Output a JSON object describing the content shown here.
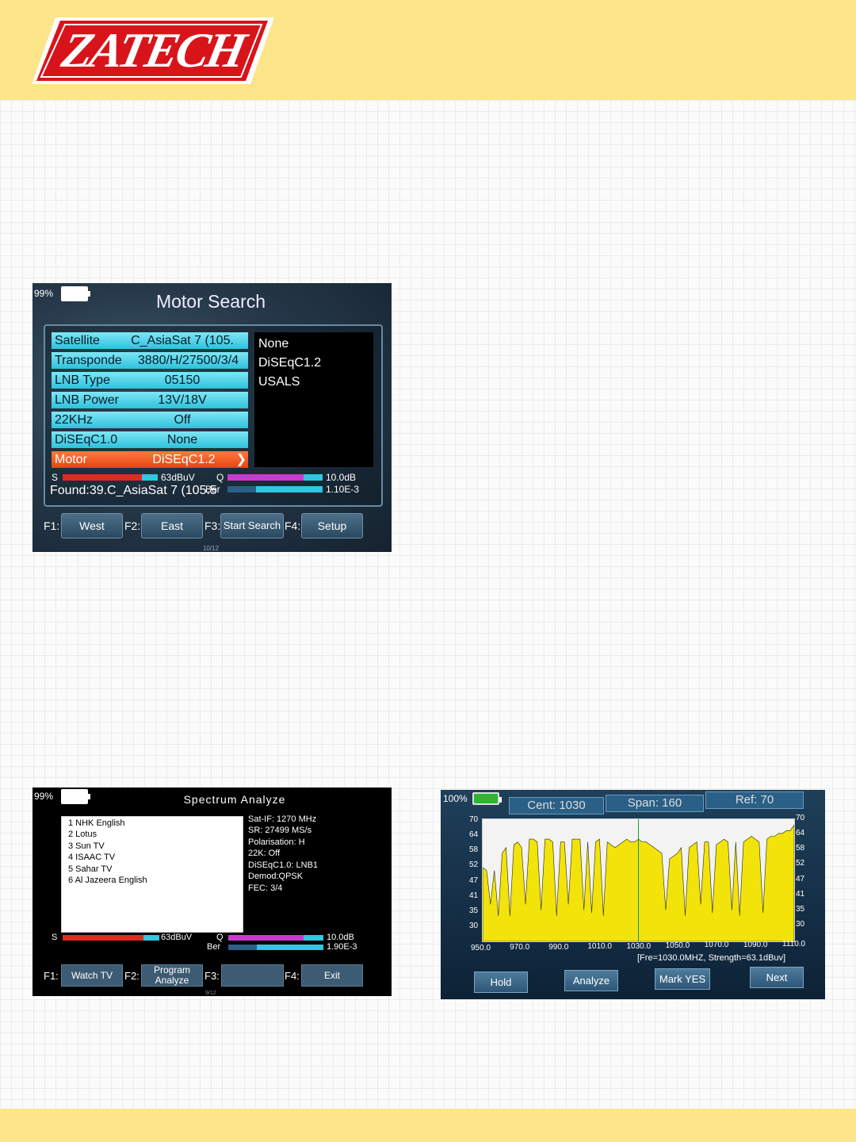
{
  "brand": {
    "logo_text": "ZATECH"
  },
  "motor_search": {
    "battery": "99%",
    "title": "Motor Search",
    "rows": [
      {
        "label": "Satellite",
        "value": "C_AsiaSat 7 (105."
      },
      {
        "label": "Transponde",
        "value": "3880/H/27500/3/4"
      },
      {
        "label": "LNB Type",
        "value": "05150"
      },
      {
        "label": "LNB Power",
        "value": "13V/18V"
      },
      {
        "label": "22KHz",
        "value": "Off"
      },
      {
        "label": "DiSEqC1.0",
        "value": "None"
      },
      {
        "label": "Motor",
        "value": "DiSEqC1.2"
      }
    ],
    "options": [
      "None",
      "DiSEqC1.2",
      "USALS"
    ],
    "s_label": "S",
    "s_value": "63dBuV",
    "q_label": "Q",
    "q_value": "10.0dB",
    "ber_label": "Ber",
    "ber_value": "1.10E-3",
    "found": "Found:39.C_AsiaSat 7 (105.5",
    "f1": "F1:",
    "f1_btn": "West",
    "f2": "F2:",
    "f2_btn": "East",
    "f3": "F3:",
    "f3_btn": "Start Search",
    "f4": "F4:",
    "f4_btn": "Setup",
    "page": "10/12"
  },
  "spectrum_analyze": {
    "battery": "99%",
    "title": "Spectrum Analyze",
    "channels": [
      "1  NHK English",
      "2  Lotus",
      "3  Sun TV",
      "4  ISAAC TV",
      "5  Sahar TV",
      "6  Al Jazeera English"
    ],
    "info": [
      "Sat-IF: 1270 MHz",
      "SR: 27499 MS/s",
      "Polarisation: H",
      "22K: Off",
      "DiSEqC1.0: LNB1",
      "Demod:QPSK",
      "FEC: 3/4"
    ],
    "s_label": "S",
    "s_value": "63dBuV",
    "q_label": "Q",
    "q_value": "10.0dB",
    "ber_label": "Ber",
    "ber_value": "1.90E-3",
    "f1": "F1:",
    "f1_btn": "Watch TV",
    "f2": "F2:",
    "f2_btn_line1": "Program",
    "f2_btn_line2": "Analyze",
    "f3": "F3:",
    "f3_btn": "",
    "f4": "F4:",
    "f4_btn": "Exit",
    "page": "9/12"
  },
  "spectrum_plot": {
    "battery": "100%",
    "cent": "Cent: 1030",
    "span": "Span: 160",
    "ref": "Ref: 70",
    "readout": "[Fre=1030.0MHZ, Strength=63.1dBuv]",
    "buttons": [
      "Hold",
      "Analyze",
      "Mark YES",
      "Next"
    ]
  },
  "chart_data": {
    "type": "area",
    "y_ticks": [
      "70",
      "64",
      "58",
      "52",
      "47",
      "41",
      "35",
      "30"
    ],
    "y_ticks_right": [
      "70",
      "64",
      "58",
      "52",
      "47",
      "41",
      "35",
      "30"
    ],
    "x_ticks": [
      "950.0",
      "970.0",
      "990.0",
      "1010.0",
      "1030.0",
      "1050.0",
      "1070.0",
      "1090.0",
      "1110.0"
    ],
    "xlim": [
      950,
      1110
    ],
    "ylim": [
      27,
      70
    ],
    "marker_x": 1030,
    "fill_color": "#f2e30a",
    "x": [
      950,
      952,
      954,
      956,
      958,
      960,
      962,
      964,
      966,
      968,
      970,
      972,
      974,
      976,
      978,
      980,
      982,
      984,
      986,
      988,
      990,
      992,
      994,
      996,
      998,
      1000,
      1002,
      1004,
      1006,
      1008,
      1010,
      1012,
      1014,
      1016,
      1018,
      1020,
      1022,
      1024,
      1026,
      1028,
      1030,
      1032,
      1034,
      1036,
      1038,
      1040,
      1042,
      1044,
      1046,
      1048,
      1050,
      1052,
      1054,
      1056,
      1058,
      1060,
      1062,
      1064,
      1066,
      1068,
      1070,
      1072,
      1074,
      1076,
      1078,
      1080,
      1082,
      1084,
      1086,
      1088,
      1090,
      1092,
      1094,
      1096,
      1098,
      1100,
      1102,
      1104,
      1106,
      1108,
      1110
    ],
    "values": [
      53,
      52,
      40,
      52,
      36,
      58,
      60,
      36,
      61,
      62,
      60,
      40,
      63,
      63,
      62,
      38,
      63,
      63,
      62,
      36,
      62,
      62,
      40,
      63,
      63,
      63,
      38,
      62,
      37,
      62,
      63,
      36,
      62,
      61,
      60,
      61,
      62,
      63,
      62,
      62,
      63,
      62,
      62,
      61,
      60,
      59,
      58,
      38,
      56,
      57,
      58,
      60,
      36,
      60,
      61,
      62,
      40,
      62,
      62,
      37,
      61,
      62,
      63,
      62,
      38,
      62,
      36,
      62,
      63,
      64,
      63,
      62,
      37,
      63,
      64,
      64,
      65,
      65,
      66,
      66,
      68
    ]
  }
}
